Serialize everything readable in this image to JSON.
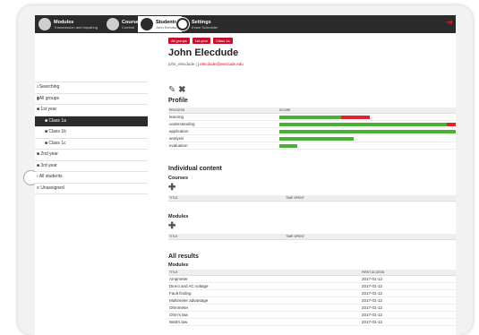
{
  "topnav": [
    {
      "title": "Modules",
      "subtitle": "Transmission and Impairing"
    },
    {
      "title": "Courses",
      "subtitle": "Combat"
    },
    {
      "title": "Students",
      "subtitle": "John Elecdude"
    },
    {
      "title": "Settings",
      "subtitle": "Exam Scheduler"
    }
  ],
  "sidebar": {
    "items": [
      {
        "label": "Searching"
      },
      {
        "label": "All groups"
      },
      {
        "label": "1st year"
      },
      {
        "label": "Class 1a"
      },
      {
        "label": "Class 1b"
      },
      {
        "label": "Class 1c"
      },
      {
        "label": "2nd year"
      },
      {
        "label": "3rd year"
      },
      {
        "label": "All students"
      },
      {
        "label": "Unassigned"
      }
    ]
  },
  "breadcrumbs": [
    "All groups",
    "1st year",
    "Class 1a"
  ],
  "student": {
    "name": "John Elecdude",
    "username": "john_elecdude",
    "email": "j.elecdude@electude.edu"
  },
  "profile": {
    "heading": "Profile",
    "col_process": "PROCESS",
    "col_score": "SCORE",
    "rows": [
      {
        "label": "learning",
        "green": 0.35,
        "red": 0.16
      },
      {
        "label": "understanding",
        "green": 0.95,
        "red": 0.08
      },
      {
        "label": "application",
        "green": 1.0,
        "red": 0
      },
      {
        "label": "analysis",
        "green": 0.42,
        "red": 0
      },
      {
        "label": "evaluation",
        "green": 0.1,
        "red": 0
      }
    ]
  },
  "individual": {
    "heading": "Individual content",
    "courses_label": "Courses",
    "modules_label": "Modules",
    "col_title": "TITLE",
    "col_time": "TIME SPENT"
  },
  "results": {
    "heading": "All results",
    "modules_label": "Modules",
    "col_title": "TITLE",
    "col_access": "FIRST ACCESS",
    "rows": [
      {
        "title": "Ampmeter",
        "date": "2017-01-12"
      },
      {
        "title": "Direct and AC voltage",
        "date": "2017-01-12"
      },
      {
        "title": "Fault finding",
        "date": "2017-01-12"
      },
      {
        "title": "Multimeter advantage",
        "date": "2017-01-12"
      },
      {
        "title": "Ohmmeter",
        "date": "2017-01-12"
      },
      {
        "title": "Ohm's law",
        "date": "2017-01-12"
      },
      {
        "title": "Watt's law",
        "date": "2017-01-12"
      }
    ]
  },
  "colors": {
    "accent": "#c8102e",
    "bar_green": "#4caf37",
    "bar_red": "#e0202e",
    "topbar": "#2b2b2b"
  },
  "icons": {
    "edit": "pencil-icon",
    "delete": "close-icon",
    "add": "plus-icon",
    "logout": "logout-icon"
  }
}
